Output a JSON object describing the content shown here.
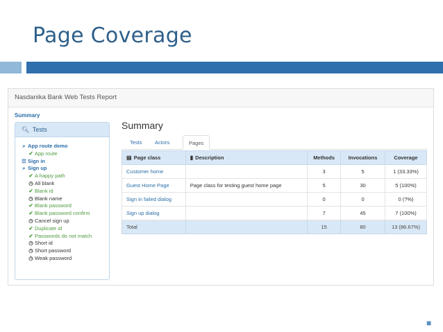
{
  "slide": {
    "title": "Page Coverage",
    "marker": "■"
  },
  "report": {
    "brand": "Nasdanika Bank Web Tests Report",
    "sidebar": {
      "heading": "Summary",
      "panel_title": "Tests",
      "tree": [
        {
          "label": "App route demo",
          "icon": "search-icon",
          "level": 1,
          "state": "heading"
        },
        {
          "label": "App route",
          "icon": "check-icon",
          "level": 2,
          "state": "pass"
        },
        {
          "label": "Sign in",
          "icon": "list-icon",
          "level": 1,
          "state": "heading"
        },
        {
          "label": "Sign up",
          "icon": "search-icon",
          "level": 1,
          "state": "heading"
        },
        {
          "label": "A happy path",
          "icon": "check-icon",
          "level": 2,
          "state": "pass"
        },
        {
          "label": "All blank",
          "icon": "clock-icon",
          "level": 2,
          "state": "pending"
        },
        {
          "label": "Blank id",
          "icon": "check-icon",
          "level": 2,
          "state": "pass"
        },
        {
          "label": "Blank name",
          "icon": "clock-icon",
          "level": 2,
          "state": "pending"
        },
        {
          "label": "Blank password",
          "icon": "check-icon",
          "level": 2,
          "state": "pass"
        },
        {
          "label": "Blank password confirm",
          "icon": "check-icon",
          "level": 2,
          "state": "pass"
        },
        {
          "label": "Cancel sign up",
          "icon": "clock-icon",
          "level": 2,
          "state": "pending"
        },
        {
          "label": "Duplicate id",
          "icon": "check-icon",
          "level": 2,
          "state": "pass"
        },
        {
          "label": "Passwords do not match",
          "icon": "check-icon",
          "level": 2,
          "state": "pass"
        },
        {
          "label": "Short id",
          "icon": "clock-icon",
          "level": 2,
          "state": "pending"
        },
        {
          "label": "Short password",
          "icon": "clock-icon",
          "level": 2,
          "state": "pending"
        },
        {
          "label": "Weak password",
          "icon": "clock-icon",
          "level": 2,
          "state": "pending"
        }
      ]
    },
    "main": {
      "title": "Summary",
      "tabs": [
        {
          "label": "Tests",
          "active": false
        },
        {
          "label": "Actors",
          "active": false
        },
        {
          "label": "Pages",
          "active": true
        }
      ],
      "table": {
        "columns": [
          "Page class",
          "Description",
          "Methods",
          "Invocations",
          "Coverage"
        ],
        "rows": [
          [
            "Customer home",
            "",
            "3",
            "5",
            "1 (33.33%)"
          ],
          [
            "Guest Home Page",
            "Page class for testing guest home page",
            "5",
            "30",
            "5 (100%)"
          ],
          [
            "Sign in failed dialog",
            "",
            "0",
            "0",
            "0 (?%)"
          ],
          [
            "Sign up dialog",
            "",
            "7",
            "45",
            "7 (100%)"
          ]
        ],
        "total": [
          "Total",
          "",
          "15",
          "80",
          "13 (86.67%)"
        ]
      }
    }
  }
}
